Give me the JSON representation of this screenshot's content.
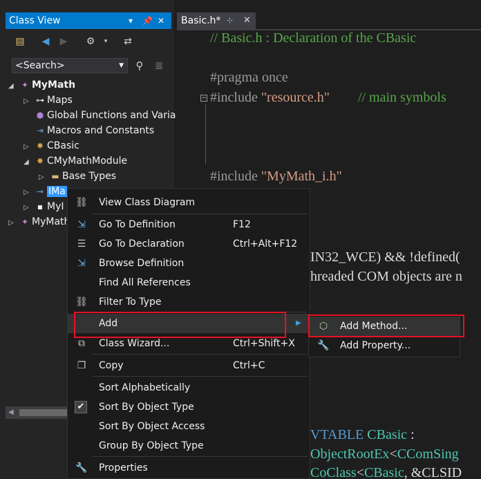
{
  "class_view": {
    "title": "Class View",
    "title_pin": "⊿",
    "title_close": "✕",
    "toolbar": {
      "new_folder_icon": "new-folder-icon",
      "back_icon": "back-icon",
      "forward_icon": "forward-icon",
      "settings_icon": "gear-icon",
      "settings_dropdown": "▾",
      "references_icon": "references-icon"
    },
    "search": {
      "value": "<Search>"
    },
    "tree": [
      {
        "label": "MyMath",
        "icon": "project-icon",
        "expanded": true
      },
      {
        "label": "Maps",
        "icon": "maps-icon"
      },
      {
        "label": "Global Functions and Varia",
        "icon": "global-functions-icon"
      },
      {
        "label": "Macros and Constants",
        "icon": "macros-icon"
      },
      {
        "label": "CBasic",
        "icon": "class-icon"
      },
      {
        "label": "CMyMathModule",
        "icon": "class-icon",
        "expanded": true
      },
      {
        "label": "Base Types",
        "icon": "folder-icon"
      },
      {
        "label": "IMa",
        "icon": "interface-icon",
        "selected": true
      },
      {
        "label": "MyI",
        "icon": "struct-icon"
      },
      {
        "label": "MyMath",
        "icon": "project-icon"
      }
    ]
  },
  "editor": {
    "tab_label": "Basic.h*",
    "tab_pin": "⊹",
    "tab_close": "✕",
    "collapse_glyph": "−",
    "lines": {
      "l1": "// Basic.h : Declaration of the CBasic",
      "l2_pp": "#pragma once",
      "l3_pp": "#include",
      "l3_str": "\"resource.h\"",
      "l3_cm": "// main symbols",
      "l4_pp": "#include",
      "l4_str": "\"MyMath_i.h\"",
      "l5": "IN32_WCE) && !defined(",
      "l6": "hreaded COM objects are n",
      "l7_kw": "VTABLE",
      "l7_ty": "CBasic",
      "l7_rest": " :",
      "l8_ty": "ObjectRootEx",
      "l8_rest": "<",
      "l8_ty2": "CComSing",
      "l9_ty": "CoClass",
      "l9_rest": "<",
      "l9_ty2": "CBasic",
      "l9_rest2": ", &CLSID"
    }
  },
  "context_menu": {
    "items": {
      "view_class_diagram": {
        "label": "View Class Diagram",
        "icon": "class-diagram-icon"
      },
      "go_to_definition": {
        "label": "Go To Definition",
        "shortcut": "F12",
        "icon": "go-to-definition-icon"
      },
      "go_to_declaration": {
        "label": "Go To Declaration",
        "shortcut": "Ctrl+Alt+F12",
        "icon": "go-to-declaration-icon"
      },
      "browse_definition": {
        "label": "Browse Definition",
        "icon": "browse-definition-icon"
      },
      "find_all_references": {
        "label": "Find All References"
      },
      "filter_to_type": {
        "label": "Filter To Type",
        "icon": "filter-type-icon"
      },
      "add": {
        "label": "Add",
        "submenu_arrow": "▶"
      },
      "class_wizard": {
        "label": "Class Wizard...",
        "shortcut": "Ctrl+Shift+X",
        "icon": "class-wizard-icon"
      },
      "copy": {
        "label": "Copy",
        "shortcut": "Ctrl+C",
        "icon": "copy-icon"
      },
      "sort_alphabetically": {
        "label": "Sort Alphabetically"
      },
      "sort_by_object_type": {
        "label": "Sort By Object Type",
        "checked": true,
        "check_glyph": "✔"
      },
      "sort_by_object_access": {
        "label": "Sort By Object Access"
      },
      "group_by_object_type": {
        "label": "Group By Object Type"
      },
      "properties": {
        "label": "Properties",
        "icon": "wrench-icon"
      }
    }
  },
  "submenu": {
    "add_method": {
      "label": "Add Method...",
      "icon": "add-method-icon"
    },
    "add_property": {
      "label": "Add Property...",
      "icon": "add-property-icon"
    }
  },
  "colors": {
    "accent": "#007acc",
    "highlight_box": "#e81123",
    "comment": "#57a64a",
    "string": "#d69d85",
    "type": "#4ec9b0",
    "keyword": "#569cd6"
  }
}
